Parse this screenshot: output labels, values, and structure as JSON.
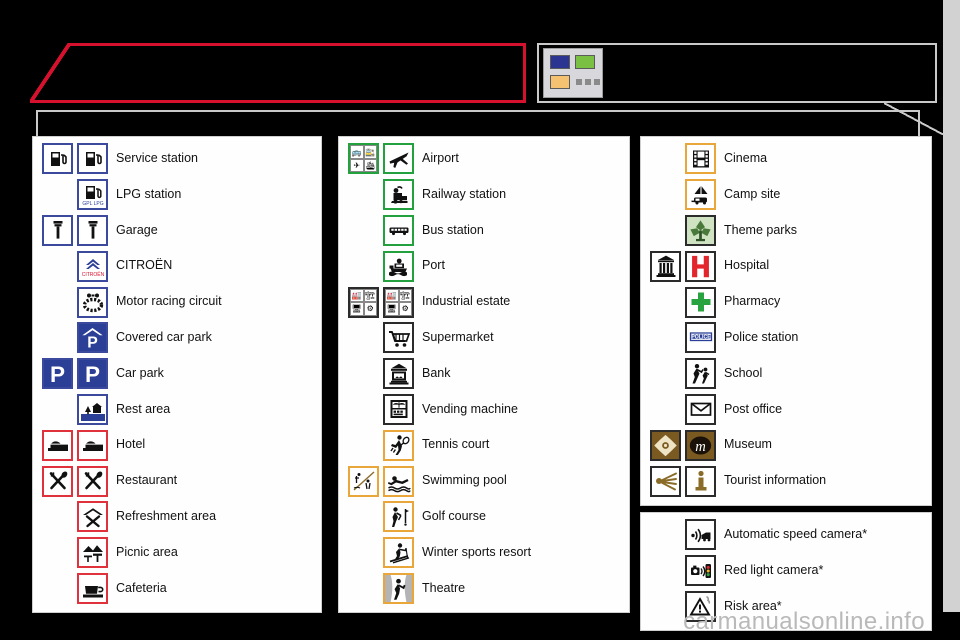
{
  "header": {
    "banner_title": "",
    "key_text": "",
    "subbar_text": "",
    "key_icon_name": "map-legend-key-icon",
    "colors": {
      "accent_red": "#d5112e",
      "swatch_blue": "#2b3490",
      "swatch_green": "#7ac043",
      "swatch_orange": "#f4c271",
      "swatch_grey": "#8a8a8a"
    }
  },
  "columns": [
    {
      "id": "col-1",
      "panels": [
        {
          "rows": [
            {
              "label": "Service station",
              "icons": [
                "fuel-pump-icon",
                "fuel-pump-icon"
              ],
              "border": "blue"
            },
            {
              "label": "LPG station",
              "icons": [
                "lpg-pump-icon"
              ],
              "border": "blue"
            },
            {
              "label": "Garage",
              "icons": [
                "spark-plug-icon",
                "spark-plug-icon"
              ],
              "border": "blue"
            },
            {
              "label": "CITROËN",
              "icons": [
                "citroen-logo-icon"
              ],
              "border": "blue"
            },
            {
              "label": "Motor racing circuit",
              "icons": [
                "racing-circuit-icon"
              ],
              "border": "blue"
            },
            {
              "label": "Covered car park",
              "icons": [
                "covered-parking-icon"
              ],
              "border": "blue"
            },
            {
              "label": "Car park",
              "icons": [
                "parking-icon",
                "parking-icon"
              ],
              "border": "blue"
            },
            {
              "label": "Rest area",
              "icons": [
                "rest-area-icon"
              ],
              "border": "blue"
            },
            {
              "label": "Hotel",
              "icons": [
                "bed-icon",
                "bed-icon"
              ],
              "border": "red"
            },
            {
              "label": "Restaurant",
              "icons": [
                "cutlery-icon",
                "cutlery-icon"
              ],
              "border": "red"
            },
            {
              "label": "Refreshment area",
              "icons": [
                "refreshment-icon"
              ],
              "border": "red"
            },
            {
              "label": "Picnic area",
              "icons": [
                "picnic-table-icon"
              ],
              "border": "red"
            },
            {
              "label": "Cafeteria",
              "icons": [
                "coffee-cup-icon"
              ],
              "border": "red"
            }
          ]
        }
      ]
    },
    {
      "id": "col-2",
      "panels": [
        {
          "rows": [
            {
              "label": "Airport",
              "icons": [
                "transport-quad-icon",
                "airplane-icon"
              ],
              "border": "green"
            },
            {
              "label": "Railway station",
              "icons": [
                "train-icon"
              ],
              "border": "green"
            },
            {
              "label": "Bus station",
              "icons": [
                "bus-icon"
              ],
              "border": "green"
            },
            {
              "label": "Port",
              "icons": [
                "ferry-icon"
              ],
              "border": "green"
            },
            {
              "label": "Industrial estate",
              "icons": [
                "industry-quad-icon",
                "industry-quad-icon"
              ],
              "border": "dark"
            },
            {
              "label": "Supermarket",
              "icons": [
                "shopping-trolley-icon"
              ],
              "border": "dark"
            },
            {
              "label": "Bank",
              "icons": [
                "bank-icon"
              ],
              "border": "dark"
            },
            {
              "label": "Vending machine",
              "icons": [
                "vending-machine-icon"
              ],
              "border": "dark"
            },
            {
              "label": "Tennis court",
              "icons": [
                "tennis-player-icon"
              ],
              "border": "orange"
            },
            {
              "label": "Swimming pool",
              "icons": [
                "sports-mix-icon",
                "swimmer-icon"
              ],
              "border": "orange"
            },
            {
              "label": "Golf course",
              "icons": [
                "golfer-icon"
              ],
              "border": "orange"
            },
            {
              "label": "Winter sports resort",
              "icons": [
                "skier-icon"
              ],
              "border": "orange"
            },
            {
              "label": "Theatre",
              "icons": [
                "theatre-icon"
              ],
              "border": "orange"
            }
          ]
        }
      ]
    },
    {
      "id": "col-3",
      "panels": [
        {
          "rows": [
            {
              "label": "Cinema",
              "icons": [
                "film-reel-icon"
              ],
              "border": "orange"
            },
            {
              "label": "Camp site",
              "icons": [
                "camp-site-icon"
              ],
              "border": "orange"
            },
            {
              "label": "Theme parks",
              "icons": [
                "theme-park-icon"
              ],
              "border": "dark"
            },
            {
              "label": "Hospital",
              "icons": [
                "clinic-building-icon",
                "hospital-h-icon"
              ],
              "border": "dark"
            },
            {
              "label": "Pharmacy",
              "icons": [
                "pharmacy-cross-icon"
              ],
              "border": "dark"
            },
            {
              "label": "Police station",
              "icons": [
                "police-sign-icon"
              ],
              "border": "dark"
            },
            {
              "label": "School",
              "icons": [
                "school-children-icon"
              ],
              "border": "dark"
            },
            {
              "label": "Post office",
              "icons": [
                "envelope-icon"
              ],
              "border": "dark"
            },
            {
              "label": "Museum",
              "icons": [
                "museum-ornament-icon",
                "museum-m-icon"
              ],
              "border": "dark"
            },
            {
              "label": "Tourist information",
              "icons": [
                "info-fan-icon",
                "info-i-icon"
              ],
              "border": "dark"
            }
          ]
        },
        {
          "rows": [
            {
              "label": "Automatic speed camera*",
              "icons": [
                "speed-camera-icon"
              ],
              "border": "dark"
            },
            {
              "label": "Red light camera*",
              "icons": [
                "red-light-camera-icon"
              ],
              "border": "dark"
            },
            {
              "label": "Risk area*",
              "icons": [
                "risk-area-icon"
              ],
              "border": "dark"
            }
          ]
        }
      ]
    }
  ],
  "watermark": "carmanualsonline.info"
}
